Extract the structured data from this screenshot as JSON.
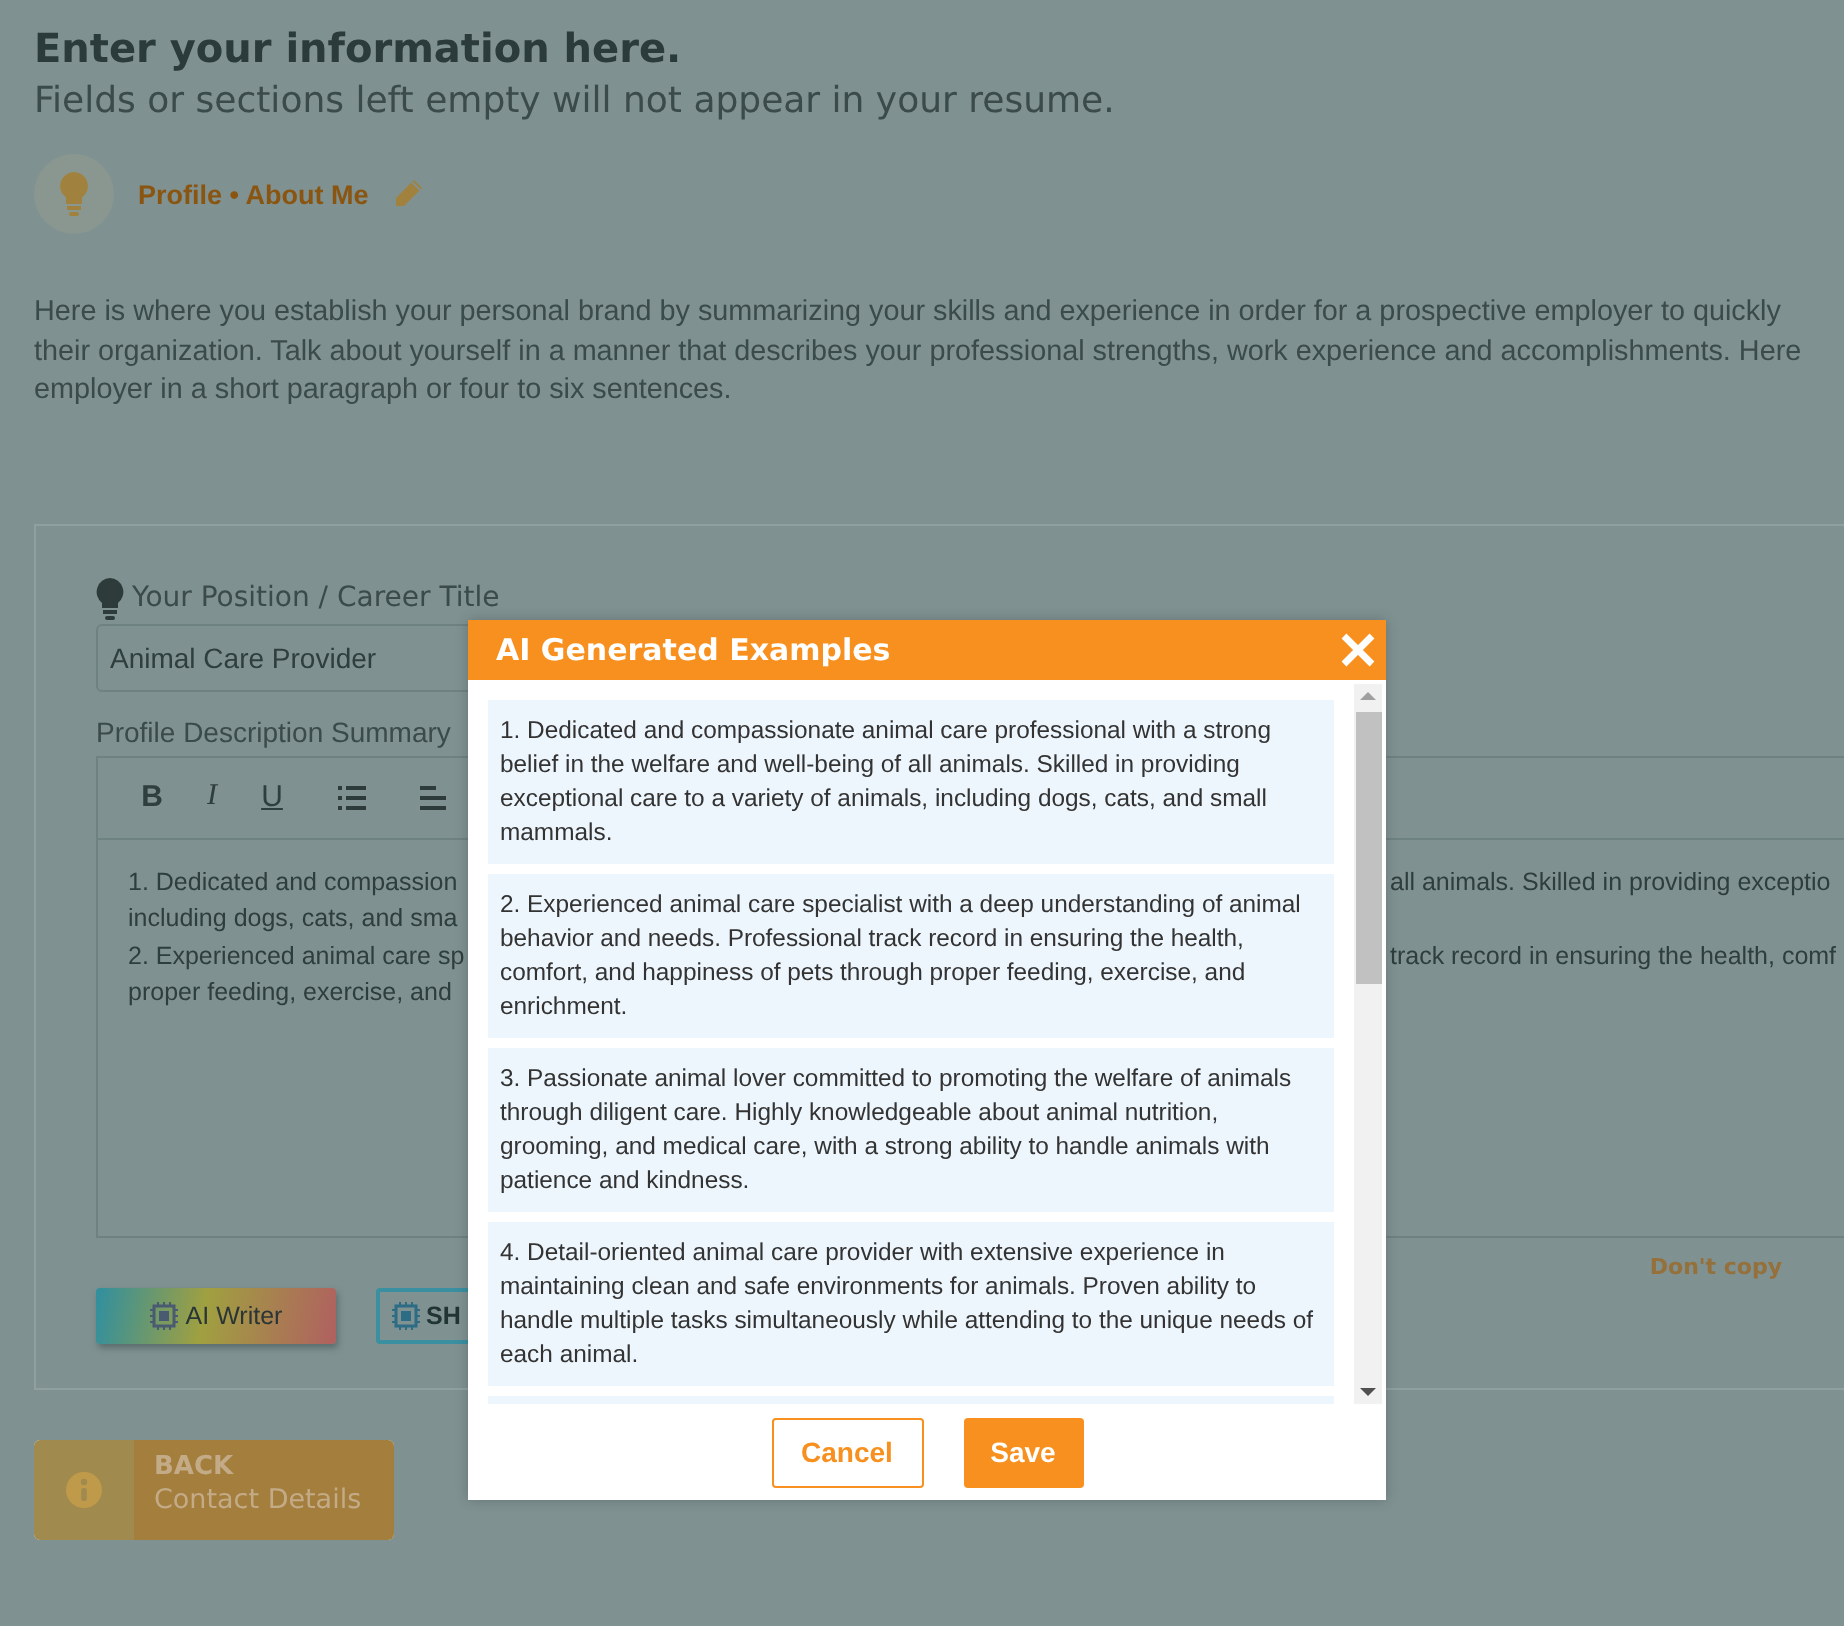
{
  "page": {
    "heading": "Enter your information here.",
    "subheading": "Fields or sections left empty will not appear in your resume."
  },
  "section": {
    "title": "Profile • About Me"
  },
  "intro": [
    "Here is where you establish your personal brand by summarizing your skills and experience in order for a prospective employer to quickly",
    "their organization. Talk about yourself in a manner that describes your professional strengths, work experience and accomplishments. Here",
    "employer in a short paragraph or four to six sentences."
  ],
  "form": {
    "position_label": "Your Position / Career Title",
    "position_value": "Animal Care Provider",
    "summary_label": "Profile Description Summary",
    "toolbar": [
      {
        "kind": "bold",
        "label": "B"
      },
      {
        "kind": "italic",
        "label": "I"
      },
      {
        "kind": "underline",
        "label": "U"
      },
      {
        "kind": "bullet-list"
      },
      {
        "kind": "align-left"
      }
    ],
    "editor_lines": [
      {
        "left": "1. Dedicated and compassion",
        "right": "all animals. Skilled in providing exceptio"
      },
      {
        "left": "including dogs, cats, and sma"
      },
      {
        "left": "2. Experienced animal care sp",
        "right": "track record in ensuring the health, comf"
      },
      {
        "left": "proper feeding, exercise, and"
      }
    ],
    "hint": "Don't copy",
    "buttons": [
      {
        "kind": "gradient",
        "label": "AI Writer"
      },
      {
        "kind": "outline",
        "label": "SH"
      }
    ]
  },
  "back": {
    "title": "BACK",
    "subtitle": "Contact Details"
  },
  "modal": {
    "title": "AI Generated Examples",
    "examples": [
      "1. Dedicated and compassionate animal care professional with a strong belief in the welfare and well-being of all animals. Skilled in providing exceptional care to a variety of animals, including dogs, cats, and small mammals.",
      "2. Experienced animal care specialist with a deep understanding of animal behavior and needs. Professional track record in ensuring the health, comfort, and happiness of pets through proper feeding, exercise, and enrichment.",
      "3. Passionate animal lover committed to promoting the welfare of animals through diligent care. Highly knowledgeable about animal nutrition, grooming, and medical care, with a strong ability to handle animals with patience and kindness.",
      "4. Detail-oriented animal care provider with extensive experience in maintaining clean and safe environments for animals. Proven ability to handle multiple tasks simultaneously while attending to the unique needs of each animal."
    ],
    "buttons": [
      {
        "kind": "outline",
        "label": "Cancel"
      },
      {
        "kind": "primary",
        "label": "Save"
      }
    ]
  }
}
